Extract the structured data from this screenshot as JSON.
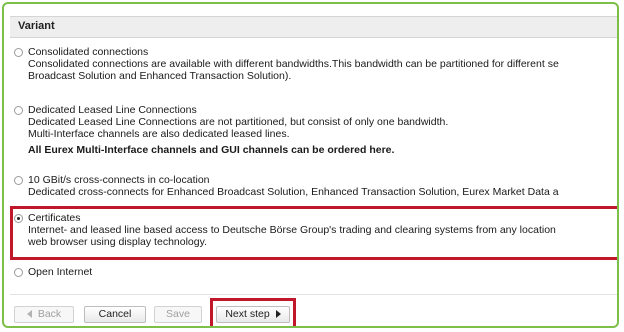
{
  "header": {
    "title": "Variant"
  },
  "options": [
    {
      "title": "Consolidated connections",
      "lines": [
        "Consolidated connections are available with different bandwidths.This bandwidth can be partitioned for different se",
        "Broadcast Solution and Enhanced Transaction Solution)."
      ],
      "selected": false
    },
    {
      "title": "Dedicated Leased Line Connections",
      "lines": [
        "Dedicated Leased Line Connections are not partitioned, but consist of only one bandwidth.",
        "Multi-Interface channels are also dedicated leased lines."
      ],
      "note": "All Eurex Multi-Interface channels and GUI channels can be ordered here.",
      "selected": false
    },
    {
      "title": "10 GBit/s cross-connects in co-location",
      "lines": [
        "Dedicated cross-connects for Enhanced Broadcast Solution, Enhanced Transaction Solution, Eurex Market Data a"
      ],
      "selected": false
    },
    {
      "title": "Certificates",
      "lines": [
        "Internet- and leased line based access to Deutsche Börse Group's trading and clearing systems from any location",
        "web browser using display technology."
      ],
      "selected": true
    },
    {
      "title": "Open Internet",
      "lines": [],
      "selected": false
    }
  ],
  "buttons": {
    "back": "Back",
    "cancel": "Cancel",
    "save": "Save",
    "next": "Next step"
  },
  "colors": {
    "highlight": "#c0172b",
    "frame": "#7cc04a"
  }
}
